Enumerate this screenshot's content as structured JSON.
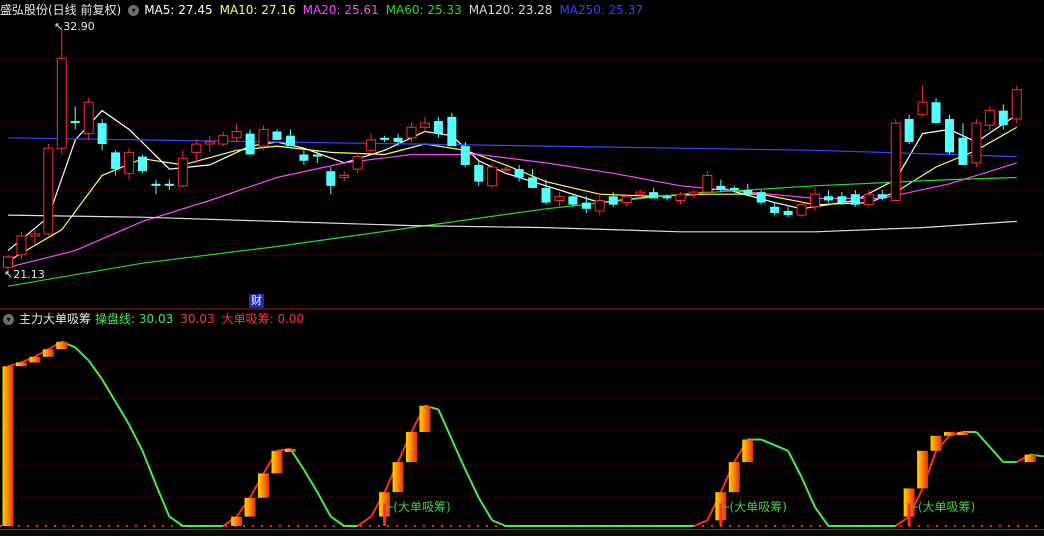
{
  "main_header": {
    "title": "盛弘股份(日线 前复权)",
    "ma": [
      {
        "label": "MA5: 27.45",
        "color": "#ffffff"
      },
      {
        "label": "MA10: 27.16",
        "color": "#ffff55"
      },
      {
        "label": "MA20: 25.61",
        "color": "#ff44ff"
      },
      {
        "label": "MA60: 25.33",
        "color": "#22dd22"
      },
      {
        "label": "MA120: 23.28",
        "color": "#dddddd"
      },
      {
        "label": "MA250: 25.37",
        "color": "#3344ff"
      }
    ]
  },
  "price_labels": {
    "high": "32.90",
    "low": "21.13"
  },
  "fin_badge": "财",
  "sub_header": {
    "title": "主力大单吸筹",
    "items": [
      {
        "label": "操盘线: 30.03",
        "color": "#44ee44"
      },
      {
        "label": "30.03",
        "color": "#ff3333"
      },
      {
        "label": "大单吸筹: 0.00",
        "color": "#ff3333"
      }
    ]
  },
  "annotation_text": "(大单吸筹)",
  "colors": {
    "up": "#ff2a2a",
    "down": "#54ffff",
    "grid": "#7a1010",
    "ctrl": "#44ee44"
  },
  "chart_data": {
    "type": "candlestick",
    "panes": [
      "price",
      "indicator"
    ],
    "price_range": [
      21.13,
      32.9
    ],
    "candles": [
      [
        21.4,
        22.0,
        21.1,
        21.9
      ],
      [
        22.0,
        23.1,
        21.8,
        22.9
      ],
      [
        22.9,
        23.2,
        22.5,
        23.0
      ],
      [
        23.0,
        27.3,
        22.9,
        27.1
      ],
      [
        27.1,
        32.9,
        26.8,
        31.4
      ],
      [
        28.4,
        29.1,
        28.0,
        28.3
      ],
      [
        27.8,
        29.5,
        27.5,
        29.3
      ],
      [
        28.3,
        28.5,
        27.0,
        27.3
      ],
      [
        26.9,
        27.0,
        25.8,
        26.1
      ],
      [
        25.9,
        27.1,
        25.6,
        26.9
      ],
      [
        26.7,
        26.8,
        25.9,
        26.0
      ],
      [
        25.4,
        25.6,
        24.9,
        25.3
      ],
      [
        25.4,
        25.6,
        25.1,
        25.3
      ],
      [
        25.3,
        27.0,
        25.2,
        26.6
      ],
      [
        26.9,
        27.5,
        26.4,
        27.3
      ],
      [
        27.3,
        27.7,
        26.9,
        27.4
      ],
      [
        27.3,
        27.9,
        27.2,
        27.7
      ],
      [
        27.6,
        28.3,
        27.4,
        27.9
      ],
      [
        27.8,
        28.0,
        26.9,
        26.8
      ],
      [
        27.2,
        28.2,
        27.0,
        28.0
      ],
      [
        27.9,
        28.0,
        27.6,
        27.5
      ],
      [
        27.7,
        28.0,
        27.5,
        27.2
      ],
      [
        26.8,
        27.0,
        26.3,
        26.5
      ],
      [
        26.8,
        27.0,
        26.4,
        26.7
      ],
      [
        26.0,
        26.2,
        24.9,
        25.3
      ],
      [
        25.7,
        26.0,
        25.5,
        25.8
      ],
      [
        26.1,
        26.9,
        25.9,
        26.7
      ],
      [
        27.0,
        27.8,
        26.9,
        27.5
      ],
      [
        27.6,
        27.7,
        27.4,
        27.5
      ],
      [
        27.6,
        27.8,
        27.2,
        27.4
      ],
      [
        27.6,
        28.3,
        27.4,
        28.1
      ],
      [
        28.1,
        28.6,
        27.9,
        28.3
      ],
      [
        28.4,
        28.6,
        27.6,
        27.8
      ],
      [
        28.6,
        28.8,
        27.4,
        27.2
      ],
      [
        27.2,
        27.4,
        26.2,
        26.3
      ],
      [
        26.3,
        26.5,
        25.3,
        25.5
      ],
      [
        25.3,
        26.4,
        25.2,
        26.2
      ],
      [
        26.1,
        26.3,
        25.9,
        26.1
      ],
      [
        26.1,
        26.3,
        25.5,
        25.7
      ],
      [
        25.7,
        26.1,
        25.4,
        25.2
      ],
      [
        25.2,
        25.6,
        24.4,
        24.5
      ],
      [
        24.6,
        25.0,
        24.3,
        24.8
      ],
      [
        24.8,
        24.9,
        24.3,
        24.4
      ],
      [
        24.5,
        24.8,
        24.0,
        24.2
      ],
      [
        24.1,
        24.9,
        23.9,
        24.6
      ],
      [
        24.8,
        25.0,
        24.3,
        24.4
      ],
      [
        24.5,
        24.9,
        24.3,
        24.8
      ],
      [
        24.9,
        25.1,
        24.6,
        25.0
      ],
      [
        25.0,
        25.2,
        24.8,
        24.7
      ],
      [
        24.8,
        24.9,
        24.6,
        24.7
      ],
      [
        24.6,
        25.0,
        24.4,
        24.9
      ],
      [
        24.9,
        25.1,
        24.7,
        25.0
      ],
      [
        25.0,
        26.0,
        24.9,
        25.8
      ],
      [
        25.3,
        25.6,
        25.0,
        25.1
      ],
      [
        25.2,
        25.3,
        25.0,
        25.1
      ],
      [
        25.1,
        25.4,
        24.8,
        24.9
      ],
      [
        25.0,
        25.1,
        24.4,
        24.5
      ],
      [
        24.3,
        24.5,
        23.9,
        24.0
      ],
      [
        24.1,
        24.3,
        23.8,
        23.9
      ],
      [
        23.9,
        24.6,
        23.8,
        24.4
      ],
      [
        24.3,
        25.2,
        24.1,
        24.9
      ],
      [
        24.8,
        25.1,
        24.5,
        24.6
      ],
      [
        24.8,
        25.0,
        24.4,
        24.5
      ],
      [
        24.9,
        25.1,
        24.3,
        24.4
      ],
      [
        24.4,
        25.1,
        24.3,
        24.9
      ],
      [
        24.9,
        25.1,
        24.6,
        24.7
      ],
      [
        24.6,
        28.5,
        24.6,
        28.3
      ],
      [
        28.5,
        28.7,
        27.3,
        27.4
      ],
      [
        28.7,
        30.1,
        28.6,
        29.3
      ],
      [
        29.3,
        29.5,
        28.5,
        28.3
      ],
      [
        28.5,
        28.7,
        26.8,
        26.9
      ],
      [
        27.6,
        28.3,
        26.4,
        26.3
      ],
      [
        26.4,
        28.5,
        26.2,
        28.3
      ],
      [
        28.2,
        29.1,
        27.9,
        28.9
      ],
      [
        28.9,
        29.2,
        28.0,
        28.2
      ],
      [
        28.5,
        30.1,
        28.3,
        29.9
      ]
    ],
    "ma_series": [
      {
        "name": "MA5",
        "color": "#ffffff",
        "points": [
          [
            0,
            22.2
          ],
          [
            3,
            23.8
          ],
          [
            5,
            27.5
          ],
          [
            7,
            28.9
          ],
          [
            9,
            28.0
          ],
          [
            12,
            26.1
          ],
          [
            15,
            26.3
          ],
          [
            18,
            27.2
          ],
          [
            20,
            27.4
          ],
          [
            22,
            27.1
          ],
          [
            25,
            26.4
          ],
          [
            28,
            27.0
          ],
          [
            31,
            27.9
          ],
          [
            33,
            27.7
          ],
          [
            35,
            26.5
          ],
          [
            37,
            25.9
          ],
          [
            40,
            25.3
          ],
          [
            44,
            24.5
          ],
          [
            48,
            24.8
          ],
          [
            51,
            24.9
          ],
          [
            53,
            25.2
          ],
          [
            57,
            24.5
          ],
          [
            59,
            24.2
          ],
          [
            63,
            24.6
          ],
          [
            66,
            25.6
          ],
          [
            68,
            27.8
          ],
          [
            70,
            28.0
          ],
          [
            72,
            27.4
          ],
          [
            75,
            28.7
          ]
        ]
      },
      {
        "name": "MA10",
        "color": "#ffff55",
        "points": [
          [
            0,
            21.7
          ],
          [
            4,
            23.2
          ],
          [
            7,
            25.8
          ],
          [
            10,
            26.6
          ],
          [
            13,
            26.3
          ],
          [
            17,
            27.0
          ],
          [
            20,
            27.2
          ],
          [
            24,
            26.9
          ],
          [
            28,
            26.8
          ],
          [
            31,
            27.3
          ],
          [
            34,
            27.0
          ],
          [
            37,
            26.3
          ],
          [
            40,
            25.5
          ],
          [
            44,
            24.9
          ],
          [
            48,
            24.8
          ],
          [
            52,
            24.9
          ],
          [
            56,
            24.9
          ],
          [
            60,
            24.4
          ],
          [
            64,
            24.5
          ],
          [
            66,
            25.0
          ],
          [
            69,
            26.2
          ],
          [
            72,
            27.0
          ],
          [
            75,
            28.1
          ]
        ]
      },
      {
        "name": "MA20",
        "color": "#ff44ff",
        "points": [
          [
            0,
            21.4
          ],
          [
            5,
            22.2
          ],
          [
            10,
            23.6
          ],
          [
            15,
            24.6
          ],
          [
            20,
            25.7
          ],
          [
            25,
            26.4
          ],
          [
            30,
            26.8
          ],
          [
            35,
            26.8
          ],
          [
            40,
            26.4
          ],
          [
            45,
            25.9
          ],
          [
            50,
            25.3
          ],
          [
            55,
            25.0
          ],
          [
            60,
            24.7
          ],
          [
            65,
            24.7
          ],
          [
            70,
            25.4
          ],
          [
            75,
            26.4
          ]
        ]
      },
      {
        "name": "MA60",
        "color": "#22dd22",
        "points": [
          [
            0,
            20.5
          ],
          [
            10,
            21.6
          ],
          [
            20,
            22.4
          ],
          [
            30,
            23.3
          ],
          [
            40,
            24.2
          ],
          [
            50,
            24.9
          ],
          [
            60,
            25.3
          ],
          [
            70,
            25.6
          ],
          [
            75,
            25.7
          ]
        ]
      },
      {
        "name": "MA120",
        "color": "#dddddd",
        "points": [
          [
            0,
            23.9
          ],
          [
            10,
            23.8
          ],
          [
            20,
            23.6
          ],
          [
            30,
            23.4
          ],
          [
            40,
            23.3
          ],
          [
            50,
            23.1
          ],
          [
            60,
            23.1
          ],
          [
            68,
            23.3
          ],
          [
            75,
            23.6
          ]
        ]
      },
      {
        "name": "MA250",
        "color": "#3344ff",
        "points": [
          [
            0,
            27.6
          ],
          [
            10,
            27.5
          ],
          [
            20,
            27.4
          ],
          [
            30,
            27.3
          ],
          [
            40,
            27.2
          ],
          [
            50,
            27.1
          ],
          [
            60,
            27.0
          ],
          [
            70,
            26.8
          ],
          [
            75,
            26.7
          ]
        ]
      }
    ],
    "indicator_range": [
      0,
      100
    ],
    "control_line": [
      85,
      87,
      90,
      94,
      98,
      95,
      88,
      78,
      66,
      54,
      40,
      22,
      5,
      0,
      0,
      0,
      0,
      5,
      15,
      28,
      40,
      41,
      30,
      18,
      5,
      0,
      0,
      5,
      18,
      34,
      50,
      64,
      62,
      46,
      30,
      15,
      3,
      0,
      0,
      0,
      0,
      0,
      0,
      0,
      0,
      0,
      0,
      0,
      0,
      0,
      0,
      0,
      3,
      18,
      34,
      46,
      46,
      43,
      40,
      26,
      10,
      0,
      0,
      0,
      0,
      0,
      0,
      5,
      20,
      40,
      48,
      50,
      50,
      42,
      34,
      34,
      38,
      37,
      46
    ],
    "bar_segments": [
      [
        0,
        0,
        85
      ],
      [
        1,
        85,
        87
      ],
      [
        2,
        87,
        90
      ],
      [
        3,
        90,
        94
      ],
      [
        4,
        94,
        98
      ],
      [
        17,
        0,
        5
      ],
      [
        18,
        5,
        15
      ],
      [
        19,
        15,
        28
      ],
      [
        20,
        28,
        40
      ],
      [
        21,
        40,
        41
      ],
      [
        28,
        5,
        18
      ],
      [
        29,
        18,
        34
      ],
      [
        30,
        34,
        50
      ],
      [
        31,
        50,
        64
      ],
      [
        53,
        3,
        18
      ],
      [
        54,
        18,
        34
      ],
      [
        55,
        34,
        46
      ],
      [
        67,
        5,
        20
      ],
      [
        68,
        20,
        40
      ],
      [
        69,
        40,
        48
      ],
      [
        70,
        48,
        50
      ],
      [
        71,
        50,
        50
      ],
      [
        76,
        34,
        38
      ],
      [
        78,
        37,
        46
      ]
    ],
    "signals": [
      28,
      53,
      67
    ],
    "annotations": [
      {
        "index": 29,
        "text": "(大单吸筹)"
      },
      {
        "index": 54,
        "text": "(大单吸筹)"
      },
      {
        "index": 68,
        "text": "(大单吸筹)"
      }
    ]
  }
}
